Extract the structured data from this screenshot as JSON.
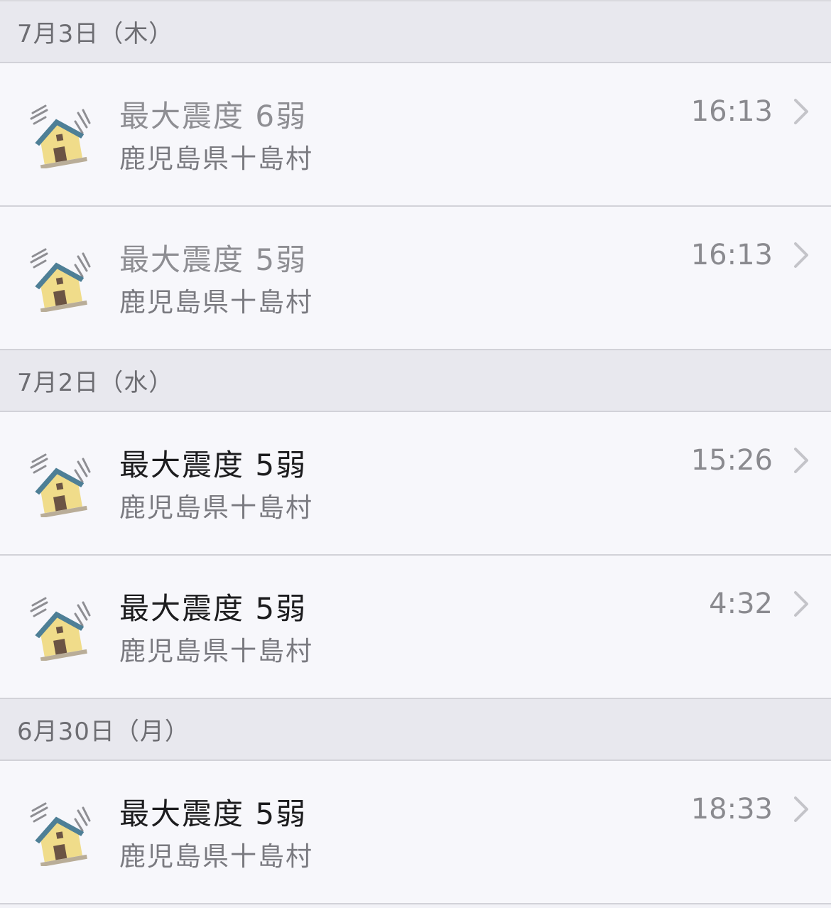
{
  "sections": [
    {
      "date": "7月3日（木）",
      "items": [
        {
          "title": "最大震度 6弱",
          "location": "鹿児島県十島村",
          "time": "16:13",
          "read": true,
          "icon": "house-shaking-icon"
        },
        {
          "title": "最大震度 5弱",
          "location": "鹿児島県十島村",
          "time": "16:13",
          "read": true,
          "icon": "house-shaking-icon"
        }
      ]
    },
    {
      "date": "7月2日（水）",
      "items": [
        {
          "title": "最大震度 5弱",
          "location": "鹿児島県十島村",
          "time": "15:26",
          "read": false,
          "icon": "house-shaking-icon"
        },
        {
          "title": "最大震度 5弱",
          "location": "鹿児島県十島村",
          "time": "4:32",
          "read": false,
          "icon": "house-shaking-icon"
        }
      ]
    },
    {
      "date": "6月30日（月）",
      "items": [
        {
          "title": "最大震度 5弱",
          "location": "鹿児島県十島村",
          "time": "18:33",
          "read": false,
          "icon": "house-shaking-icon"
        }
      ]
    }
  ],
  "colors": {
    "roof": "#4e7f96",
    "wall": "#f0dc8a",
    "door": "#6b5444",
    "ground": "#b9ad98",
    "shake_lines": "#8e8e93"
  }
}
